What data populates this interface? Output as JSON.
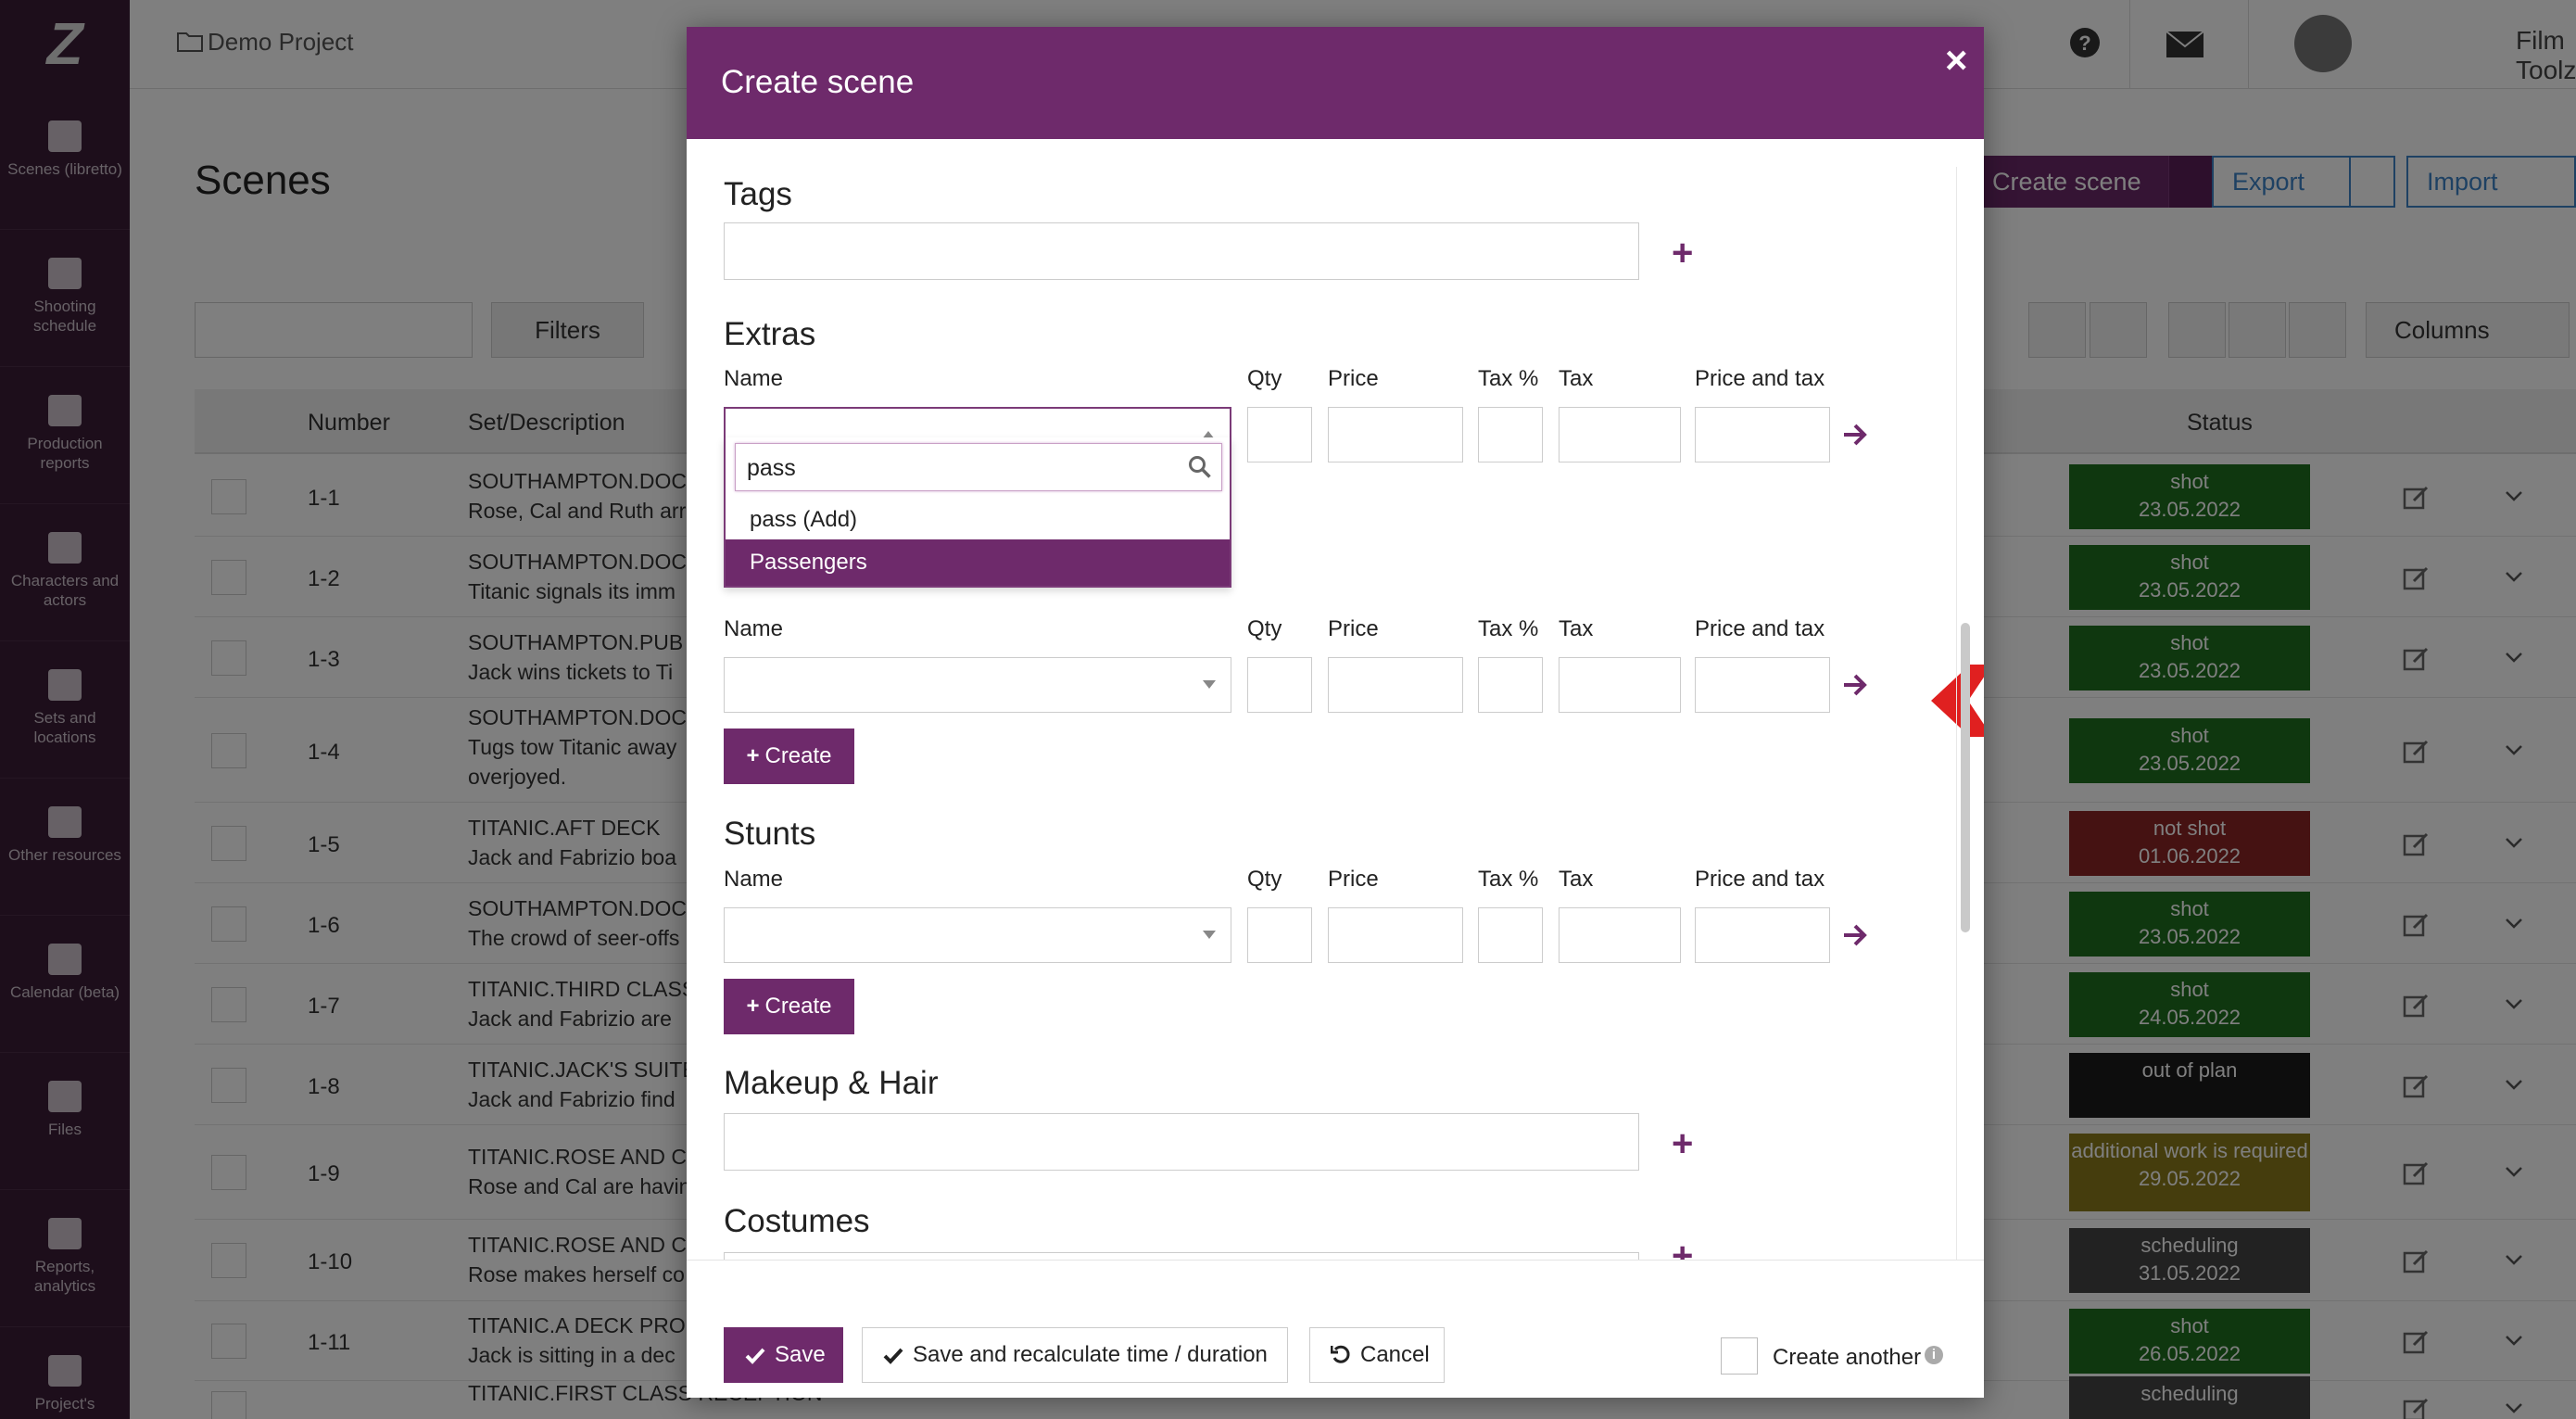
{
  "app": {
    "project": "Demo Project",
    "user": "Film Toolz",
    "page_title": "Scenes",
    "create_scene_btn": "Create scene",
    "export_btn": "Export",
    "import_btn": "Import",
    "filters_btn": "Filters",
    "columns_btn": "Columns"
  },
  "sidebar": {
    "items": [
      {
        "label": "Scenes (libretto)",
        "icon": "clapperboard-icon"
      },
      {
        "label": "Shooting schedule",
        "icon": "calendar-icon"
      },
      {
        "label": "Production reports",
        "icon": "checkbox-icon"
      },
      {
        "label": "Characters and actors",
        "icon": "people-icon"
      },
      {
        "label": "Sets and locations",
        "icon": "image-icon"
      },
      {
        "label": "Other resources",
        "icon": "archive-icon"
      },
      {
        "label": "Calendar (beta)",
        "icon": "calendar-icon"
      },
      {
        "label": "Files",
        "icon": "file-icon"
      },
      {
        "label": "Reports, analytics",
        "icon": "bar-chart-icon"
      },
      {
        "label": "Project's",
        "icon": "sliders-icon"
      }
    ]
  },
  "table": {
    "headers": {
      "number": "Number",
      "set": "Set/Description",
      "status": "Status"
    },
    "rows": [
      {
        "num": "1-1",
        "l1": "SOUTHAMPTON.DOC",
        "l2": "Rose, Cal and Ruth arr",
        "l3": "",
        "s1": "shot",
        "s2": "23.05.2022",
        "color": "#1f6e1f"
      },
      {
        "num": "1-2",
        "l1": "SOUTHAMPTON.DOC",
        "l2": "Titanic signals its imm",
        "l3": "",
        "s1": "shot",
        "s2": "23.05.2022",
        "color": "#1f6e1f"
      },
      {
        "num": "1-3",
        "l1": "SOUTHAMPTON.PUB",
        "l2": "Jack wins tickets to Ti",
        "l3": "",
        "s1": "shot",
        "s2": "23.05.2022",
        "color": "#1f6e1f"
      },
      {
        "num": "1-4",
        "l1": "SOUTHAMPTON.DOC",
        "l2": "Tugs tow Titanic away",
        "l3": "overjoyed.",
        "s1": "shot",
        "s2": "23.05.2022",
        "color": "#1f6e1f"
      },
      {
        "num": "1-5",
        "l1": "TITANIC.AFT DECK",
        "l2": "Jack and Fabrizio boa",
        "l3": "",
        "s1": "not shot",
        "s2": "01.06.2022",
        "color": "#8a2424"
      },
      {
        "num": "1-6",
        "l1": "SOUTHAMPTON.DOC",
        "l2": "The crowd of seer-offs",
        "l3": "",
        "s1": "shot",
        "s2": "23.05.2022",
        "color": "#1f6e1f"
      },
      {
        "num": "1-7",
        "l1": "TITANIC.THIRD CLASS",
        "l2": "Jack and Fabrizio are",
        "l3": "",
        "s1": "shot",
        "s2": "24.05.2022",
        "color": "#1f6e1f"
      },
      {
        "num": "1-8",
        "l1": "TITANIC.JACK'S SUITE",
        "l2": "Jack and Fabrizio find",
        "l3": "",
        "s1": "out of plan",
        "s2": "",
        "color": "#1a1a1a"
      },
      {
        "num": "1-9",
        "l1": "TITANIC.ROSE AND CA",
        "l2": "Rose and Cal are havin",
        "l3": "",
        "s1": "additional work is required",
        "s2": "29.05.2022",
        "color": "#8a7a1a"
      },
      {
        "num": "1-10",
        "l1": "TITANIC.ROSE AND CA",
        "l2": "Rose makes herself co",
        "l3": "",
        "s1": "scheduling",
        "s2": "31.05.2022",
        "color": "#444444"
      },
      {
        "num": "1-11",
        "l1": "TITANIC.A DECK PROM",
        "l2": "Jack is sitting in a dec",
        "l3": "",
        "s1": "shot",
        "s2": "26.05.2022",
        "color": "#1f6e1f"
      },
      {
        "num": "",
        "l1": "TITANIC.FIRST CLASS RECEPTION",
        "l2": "",
        "l3": "",
        "s1": "scheduling",
        "s2": "",
        "color": "#444444"
      }
    ]
  },
  "modal": {
    "title": "Create scene",
    "close": "×",
    "tags_title": "Tags",
    "extras_title": "Extras",
    "stunts_title": "Stunts",
    "makeup_title": "Makeup & Hair",
    "costumes_title": "Costumes",
    "cols": {
      "name": "Name",
      "qty": "Qty",
      "price": "Price",
      "tax_pct": "Tax %",
      "tax": "Tax",
      "price_tax": "Price and tax"
    },
    "create_btn": "Create",
    "dropdown": {
      "search_value": "pass",
      "options": [
        "pass (Add)",
        "Passengers"
      ],
      "active_index": 1
    },
    "footer": {
      "save": "Save",
      "save_recalc": "Save and recalculate time / duration",
      "cancel": "Cancel",
      "create_another": "Create another"
    }
  },
  "colors": {
    "brand": "#6e2a6b",
    "hint_arrow": "#e02020"
  }
}
